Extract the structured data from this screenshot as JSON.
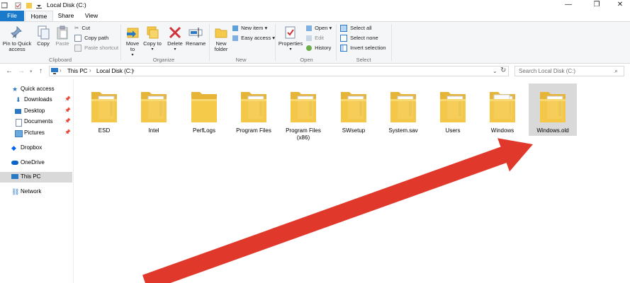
{
  "window": {
    "title": "Local Disk (C:)"
  },
  "tabs": {
    "file": "File",
    "home": "Home",
    "share": "Share",
    "view": "View"
  },
  "ribbon": {
    "clipboard": {
      "pin": "Pin to Quick access",
      "copy": "Copy",
      "paste": "Paste",
      "cut": "Cut",
      "copy_path": "Copy path",
      "paste_shortcut": "Paste shortcut",
      "label": "Clipboard"
    },
    "organize": {
      "move_to": "Move to",
      "copy_to": "Copy to",
      "delete": "Delete",
      "rename": "Rename",
      "label": "Organize"
    },
    "new": {
      "new_folder": "New folder",
      "new_item": "New item",
      "easy_access": "Easy access",
      "label": "New"
    },
    "open": {
      "properties": "Properties",
      "open": "Open",
      "edit": "Edit",
      "history": "History",
      "label": "Open"
    },
    "select": {
      "select_all": "Select all",
      "select_none": "Select none",
      "invert": "Invert selection",
      "label": "Select"
    }
  },
  "address": {
    "crumb1": "This PC",
    "crumb2": "Local Disk (C:)",
    "search_placeholder": "Search Local Disk (C:)"
  },
  "nav": {
    "quick_access": "Quick access",
    "downloads": "Downloads",
    "desktop": "Desktop",
    "documents": "Documents",
    "pictures": "Pictures",
    "dropbox": "Dropbox",
    "onedrive": "OneDrive",
    "this_pc": "This PC",
    "network": "Network"
  },
  "folders": [
    {
      "name": "ESD"
    },
    {
      "name": "Intel"
    },
    {
      "name": "PerfLogs"
    },
    {
      "name": "Program Files"
    },
    {
      "name": "Program Files (x86)"
    },
    {
      "name": "SWsetup"
    },
    {
      "name": "System.sav"
    },
    {
      "name": "Users"
    },
    {
      "name": "Windows"
    },
    {
      "name": "Windows.old"
    }
  ],
  "colors": {
    "accent": "#1979ca",
    "folder": "#f5c94a",
    "arrow": "#e0392b",
    "selection": "#d9d9d9"
  }
}
